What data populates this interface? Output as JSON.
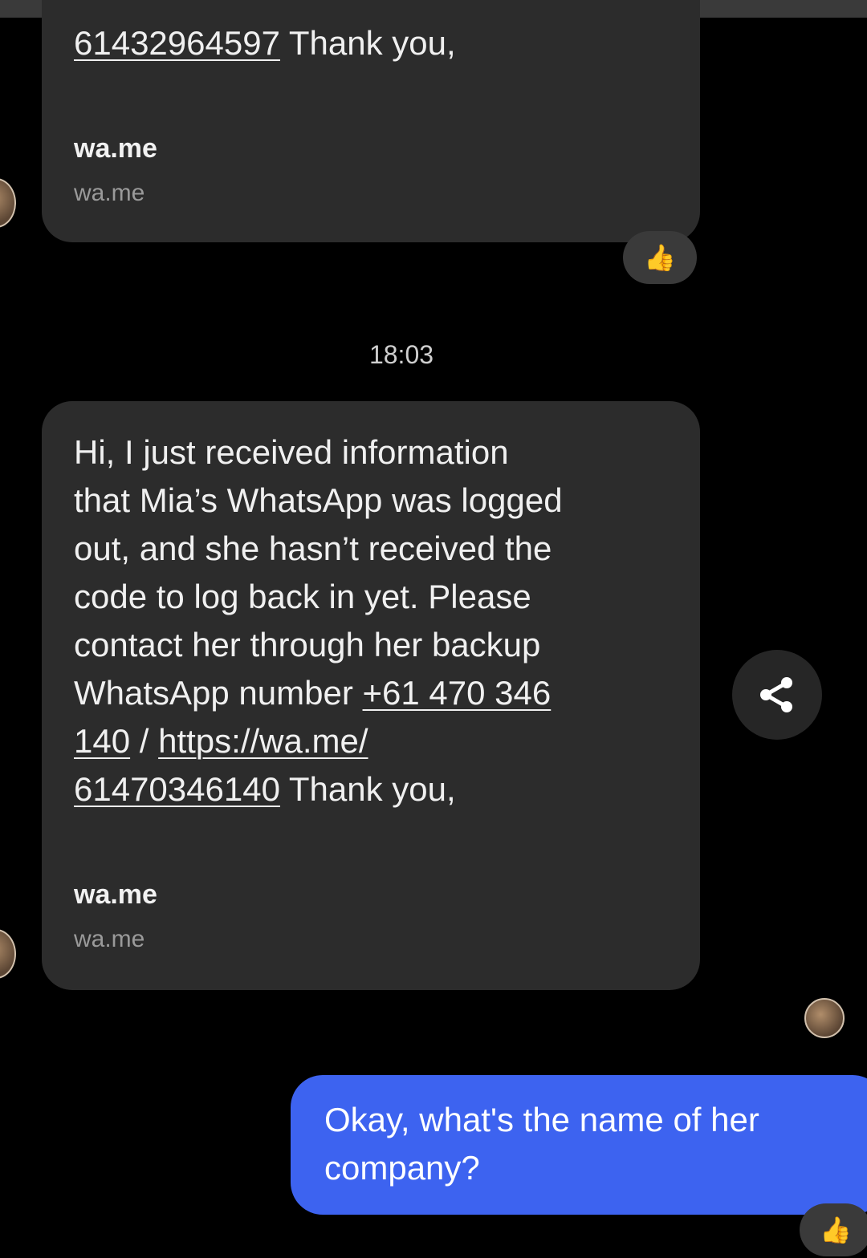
{
  "conversation": {
    "msg1": {
      "lines": [
        "61432964597 Thank you,"
      ],
      "link_part": "61432964597",
      "after_link": " Thank you,",
      "preview_title": "wa.me",
      "preview_domain": "wa.me",
      "reaction": "thumbs-up"
    },
    "timestamp": "18:03",
    "msg2": {
      "line1": "Hi, I just received information",
      "line2": "that Mia’s WhatsApp was logged",
      "line3": "out, and she hasn’t received the",
      "line4": "code to log back in yet. Please",
      "line5": "contact her through her backup",
      "line6_prefix": "WhatsApp number ",
      "line6_link": "+61 470 346",
      "line7_link1": "140",
      "line7_sep": " / ",
      "line7_link2": "https://wa.me/",
      "line8_link": "61470346140",
      "line8_suffix": " Thank you,",
      "preview_title": "wa.me",
      "preview_domain": "wa.me"
    },
    "msg3": {
      "line1": "Okay, what's the name of her",
      "line2": "company?",
      "reaction": "thumbs-up"
    }
  },
  "icons": {
    "share": "share-icon",
    "reaction": "thumbs-up-icon",
    "avatar": "contact-avatar"
  },
  "colors": {
    "background": "#000000",
    "incoming_bubble": "#2c2c2c",
    "outgoing_bubble": "#3d63f0",
    "reaction_emoji": "#f2b625"
  }
}
